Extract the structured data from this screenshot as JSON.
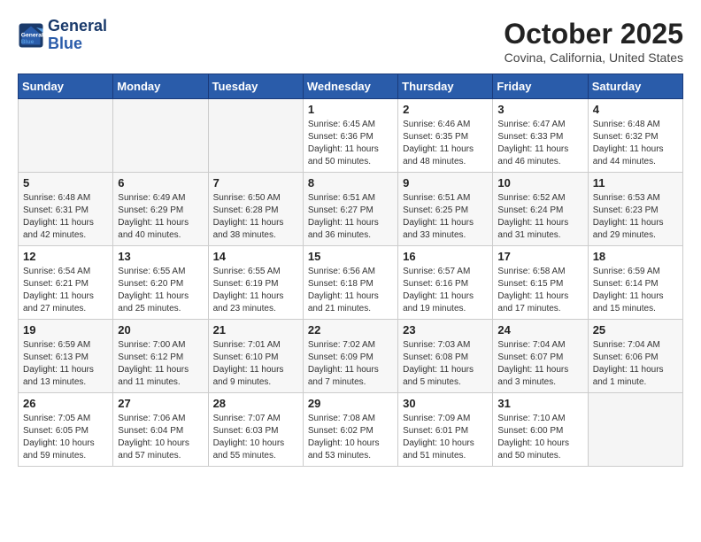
{
  "header": {
    "logo_line1": "General",
    "logo_line2": "Blue",
    "month": "October 2025",
    "location": "Covina, California, United States"
  },
  "days_of_week": [
    "Sunday",
    "Monday",
    "Tuesday",
    "Wednesday",
    "Thursday",
    "Friday",
    "Saturday"
  ],
  "weeks": [
    {
      "row_class": "row-odd",
      "days": [
        {
          "num": "",
          "info": "",
          "empty": true
        },
        {
          "num": "",
          "info": "",
          "empty": true
        },
        {
          "num": "",
          "info": "",
          "empty": true
        },
        {
          "num": "1",
          "info": "Sunrise: 6:45 AM\nSunset: 6:36 PM\nDaylight: 11 hours\nand 50 minutes."
        },
        {
          "num": "2",
          "info": "Sunrise: 6:46 AM\nSunset: 6:35 PM\nDaylight: 11 hours\nand 48 minutes."
        },
        {
          "num": "3",
          "info": "Sunrise: 6:47 AM\nSunset: 6:33 PM\nDaylight: 11 hours\nand 46 minutes."
        },
        {
          "num": "4",
          "info": "Sunrise: 6:48 AM\nSunset: 6:32 PM\nDaylight: 11 hours\nand 44 minutes."
        }
      ]
    },
    {
      "row_class": "row-even",
      "days": [
        {
          "num": "5",
          "info": "Sunrise: 6:48 AM\nSunset: 6:31 PM\nDaylight: 11 hours\nand 42 minutes."
        },
        {
          "num": "6",
          "info": "Sunrise: 6:49 AM\nSunset: 6:29 PM\nDaylight: 11 hours\nand 40 minutes."
        },
        {
          "num": "7",
          "info": "Sunrise: 6:50 AM\nSunset: 6:28 PM\nDaylight: 11 hours\nand 38 minutes."
        },
        {
          "num": "8",
          "info": "Sunrise: 6:51 AM\nSunset: 6:27 PM\nDaylight: 11 hours\nand 36 minutes."
        },
        {
          "num": "9",
          "info": "Sunrise: 6:51 AM\nSunset: 6:25 PM\nDaylight: 11 hours\nand 33 minutes."
        },
        {
          "num": "10",
          "info": "Sunrise: 6:52 AM\nSunset: 6:24 PM\nDaylight: 11 hours\nand 31 minutes."
        },
        {
          "num": "11",
          "info": "Sunrise: 6:53 AM\nSunset: 6:23 PM\nDaylight: 11 hours\nand 29 minutes."
        }
      ]
    },
    {
      "row_class": "row-odd",
      "days": [
        {
          "num": "12",
          "info": "Sunrise: 6:54 AM\nSunset: 6:21 PM\nDaylight: 11 hours\nand 27 minutes."
        },
        {
          "num": "13",
          "info": "Sunrise: 6:55 AM\nSunset: 6:20 PM\nDaylight: 11 hours\nand 25 minutes."
        },
        {
          "num": "14",
          "info": "Sunrise: 6:55 AM\nSunset: 6:19 PM\nDaylight: 11 hours\nand 23 minutes."
        },
        {
          "num": "15",
          "info": "Sunrise: 6:56 AM\nSunset: 6:18 PM\nDaylight: 11 hours\nand 21 minutes."
        },
        {
          "num": "16",
          "info": "Sunrise: 6:57 AM\nSunset: 6:16 PM\nDaylight: 11 hours\nand 19 minutes."
        },
        {
          "num": "17",
          "info": "Sunrise: 6:58 AM\nSunset: 6:15 PM\nDaylight: 11 hours\nand 17 minutes."
        },
        {
          "num": "18",
          "info": "Sunrise: 6:59 AM\nSunset: 6:14 PM\nDaylight: 11 hours\nand 15 minutes."
        }
      ]
    },
    {
      "row_class": "row-even",
      "days": [
        {
          "num": "19",
          "info": "Sunrise: 6:59 AM\nSunset: 6:13 PM\nDaylight: 11 hours\nand 13 minutes."
        },
        {
          "num": "20",
          "info": "Sunrise: 7:00 AM\nSunset: 6:12 PM\nDaylight: 11 hours\nand 11 minutes."
        },
        {
          "num": "21",
          "info": "Sunrise: 7:01 AM\nSunset: 6:10 PM\nDaylight: 11 hours\nand 9 minutes."
        },
        {
          "num": "22",
          "info": "Sunrise: 7:02 AM\nSunset: 6:09 PM\nDaylight: 11 hours\nand 7 minutes."
        },
        {
          "num": "23",
          "info": "Sunrise: 7:03 AM\nSunset: 6:08 PM\nDaylight: 11 hours\nand 5 minutes."
        },
        {
          "num": "24",
          "info": "Sunrise: 7:04 AM\nSunset: 6:07 PM\nDaylight: 11 hours\nand 3 minutes."
        },
        {
          "num": "25",
          "info": "Sunrise: 7:04 AM\nSunset: 6:06 PM\nDaylight: 11 hours\nand 1 minute."
        }
      ]
    },
    {
      "row_class": "row-odd",
      "days": [
        {
          "num": "26",
          "info": "Sunrise: 7:05 AM\nSunset: 6:05 PM\nDaylight: 10 hours\nand 59 minutes."
        },
        {
          "num": "27",
          "info": "Sunrise: 7:06 AM\nSunset: 6:04 PM\nDaylight: 10 hours\nand 57 minutes."
        },
        {
          "num": "28",
          "info": "Sunrise: 7:07 AM\nSunset: 6:03 PM\nDaylight: 10 hours\nand 55 minutes."
        },
        {
          "num": "29",
          "info": "Sunrise: 7:08 AM\nSunset: 6:02 PM\nDaylight: 10 hours\nand 53 minutes."
        },
        {
          "num": "30",
          "info": "Sunrise: 7:09 AM\nSunset: 6:01 PM\nDaylight: 10 hours\nand 51 minutes."
        },
        {
          "num": "31",
          "info": "Sunrise: 7:10 AM\nSunset: 6:00 PM\nDaylight: 10 hours\nand 50 minutes."
        },
        {
          "num": "",
          "info": "",
          "empty": true
        }
      ]
    }
  ]
}
